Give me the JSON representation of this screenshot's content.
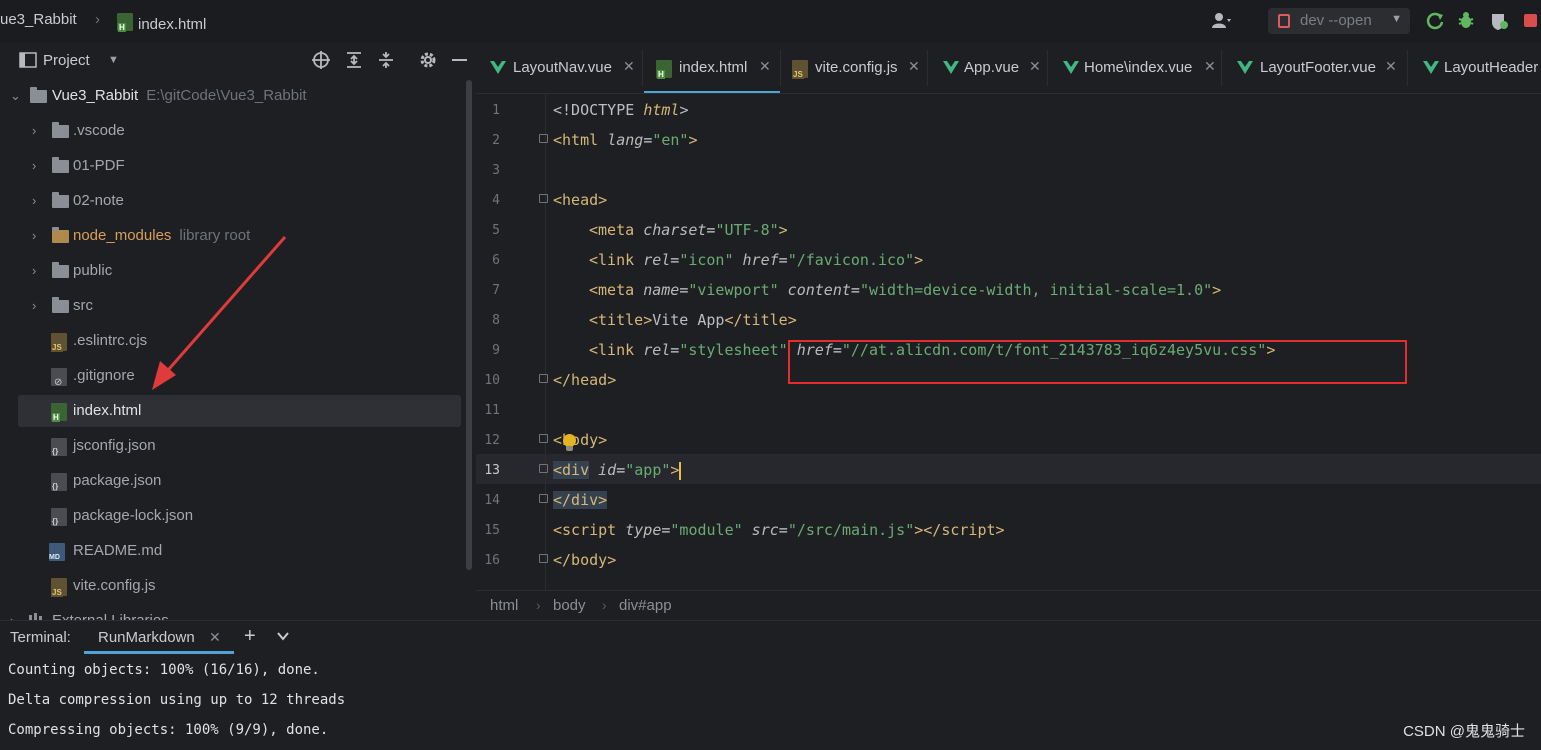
{
  "topbar": {
    "project_crumb": "ue3_Rabbit",
    "file_crumb": "index.html",
    "run_config": "dev --open"
  },
  "project_panel": {
    "title": "Project",
    "root": {
      "name": "Vue3_Rabbit",
      "path": "E:\\gitCode\\Vue3_Rabbit"
    },
    "items": [
      {
        "label": "vscode",
        "prefix": ".",
        "kind": "folder"
      },
      {
        "label": "01-PDF",
        "kind": "folder"
      },
      {
        "label": "02-note",
        "kind": "folder"
      },
      {
        "label": "node_modules",
        "hint": "library root",
        "kind": "folder"
      },
      {
        "label": "public",
        "kind": "folder"
      },
      {
        "label": "src",
        "kind": "folder"
      },
      {
        "label": ".eslintrc.cjs",
        "kind": "js"
      },
      {
        "label": ".gitignore",
        "kind": "git"
      },
      {
        "label": "index.html",
        "kind": "html"
      },
      {
        "label": "jsconfig.json",
        "kind": "json"
      },
      {
        "label": "package.json",
        "kind": "json"
      },
      {
        "label": "package-lock.json",
        "kind": "json"
      },
      {
        "label": "README.md",
        "kind": "md"
      },
      {
        "label": "vite.config.js",
        "kind": "js"
      }
    ],
    "partial_item": "External Libraries"
  },
  "tabs": [
    {
      "label": "LayoutNav.vue",
      "icon": "vue-icon"
    },
    {
      "label": "index.html",
      "icon": "html-file-icon",
      "active": true
    },
    {
      "label": "vite.config.js",
      "icon": "js-file-icon"
    },
    {
      "label": "App.vue",
      "icon": "vue-icon"
    },
    {
      "label": "Home\\index.vue",
      "icon": "vue-icon"
    },
    {
      "label": "LayoutFooter.vue",
      "icon": "vue-icon"
    },
    {
      "label": "LayoutHeader",
      "icon": "vue-icon"
    }
  ],
  "editor": {
    "line_numbers": [
      "1",
      "2",
      "3",
      "4",
      "5",
      "6",
      "7",
      "8",
      "9",
      "10",
      "11",
      "12",
      "13",
      "14",
      "15",
      "16"
    ],
    "current_line": "13",
    "code": {
      "l1_a": "<!DOCTYPE ",
      "l1_b": "html",
      "l1_c": ">",
      "l2_a": "<html ",
      "l2_b": "lang",
      "l2_c": "=",
      "l2_d": "\"en\"",
      "l2_e": ">",
      "l4_a": "<head",
      "l4_b": ">",
      "l5_a": "<meta ",
      "l5_b": "charset",
      "l5_c": "=",
      "l5_d": "\"UTF-8\"",
      "l5_e": ">",
      "l6_a": "<link ",
      "l6_b": "rel",
      "l6_c": "=",
      "l6_d": "\"icon\"",
      "l6_e": " href",
      "l6_f": "=",
      "l6_g": "\"/favicon.ico\"",
      "l6_h": ">",
      "l7_a": "<meta ",
      "l7_b": "name",
      "l7_c": "=",
      "l7_d": "\"viewport\"",
      "l7_e": " content",
      "l7_f": "=",
      "l7_g": "\"width=device-width, initial-scale=1.0\"",
      "l7_h": ">",
      "l8_a": "<title",
      "l8_b": ">",
      "l8_c": "Vite App",
      "l8_d": "</title",
      "l8_e": ">",
      "l9_a": "<link ",
      "l9_b": "rel",
      "l9_c": "=",
      "l9_d": "\"stylesheet\"",
      "l9_e": " href",
      "l9_f": "=",
      "l9_g": "\"//at.alicdn.com/t/font_2143783_iq6z4ey5vu.css\"",
      "l9_h": ">",
      "l10_a": "</head",
      "l10_b": ">",
      "l12_a": "<",
      "l12_b": "body",
      "l12_c": ">",
      "l13_a": "<div",
      "l13_b": " id",
      "l13_c": "=",
      "l13_d": "\"app\"",
      "l13_e": ">",
      "l14_a": "</div",
      "l14_b": ">",
      "l15_a": "<script ",
      "l15_b": "type",
      "l15_c": "=",
      "l15_d": "\"module\"",
      "l15_e": " src",
      "l15_f": "=",
      "l15_g": "\"/src/main.js\"",
      "l15_h": "></script",
      "l15_i": ">",
      "l16_a": "</body",
      "l16_b": ">"
    }
  },
  "breadcrumbs": [
    "html",
    "body",
    "div#app"
  ],
  "terminal": {
    "title": "Terminal:",
    "tab": "RunMarkdown",
    "lines": [
      "Counting objects: 100% (16/16), done.",
      "Delta compression using up to 12 threads",
      "Compressing objects: 100% (9/9), done."
    ]
  },
  "watermark": "CSDN @鬼鬼骑士",
  "colors": {
    "background": "#1e1f22",
    "tag": "#d5b778",
    "string": "#6aab73",
    "accent": "#4fa3d6",
    "highlight_box": "#e52d2d",
    "arrow": "#e03b3b"
  }
}
